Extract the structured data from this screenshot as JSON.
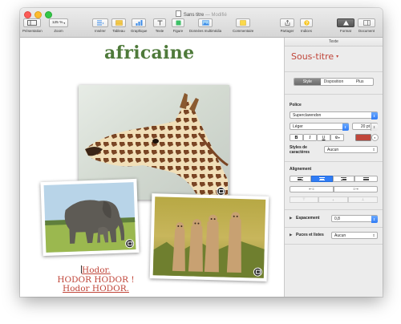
{
  "window": {
    "title": "Sans titre",
    "edited": "— Modifié"
  },
  "toolbar": {
    "presentation": "Présentation",
    "zoom_value": "125 %",
    "zoom": "Zoom",
    "insert": "Insérer",
    "table": "Tableau",
    "chart": "Graphique",
    "text": "Texte",
    "shape": "Figure",
    "media": "Données multimédia",
    "comment": "Commentaire",
    "share": "Partager",
    "tips": "Indices",
    "format": "Format",
    "document": "Document"
  },
  "canvas": {
    "heading": "africaine",
    "body_lines": [
      "Hodor.",
      "HODOR HODOR !",
      "Hodor HODOR."
    ]
  },
  "sidebar": {
    "tab": "Texte",
    "style_name": "Sous-titre",
    "segments": [
      "Style",
      "Disposition",
      "Plus"
    ],
    "font_header": "Police",
    "font_name": "Superclarendon",
    "font_weight": "Léger",
    "font_size": "20 pt",
    "bold": "B",
    "italic": "I",
    "underline": "U",
    "gear": "⚙",
    "text_color": "#c0463a",
    "char_styles_label": "Styles de caractères",
    "char_styles_value": "Aucun",
    "alignment_header": "Alignement",
    "spacing_label": "Espacement",
    "spacing_value": "0,8",
    "bullets_label": "Puces et listes",
    "bullets_value": "Aucun"
  },
  "colors": {
    "heading": "#4e7a3a",
    "accent_text": "#c0463a",
    "selection_blue": "#2f7cf6"
  },
  "icons": [
    "presentation-icon",
    "insert-icon",
    "table-icon",
    "chart-icon",
    "text-icon",
    "shape-icon",
    "media-icon",
    "comment-icon",
    "share-icon",
    "tips-icon",
    "format-icon",
    "document-icon"
  ]
}
